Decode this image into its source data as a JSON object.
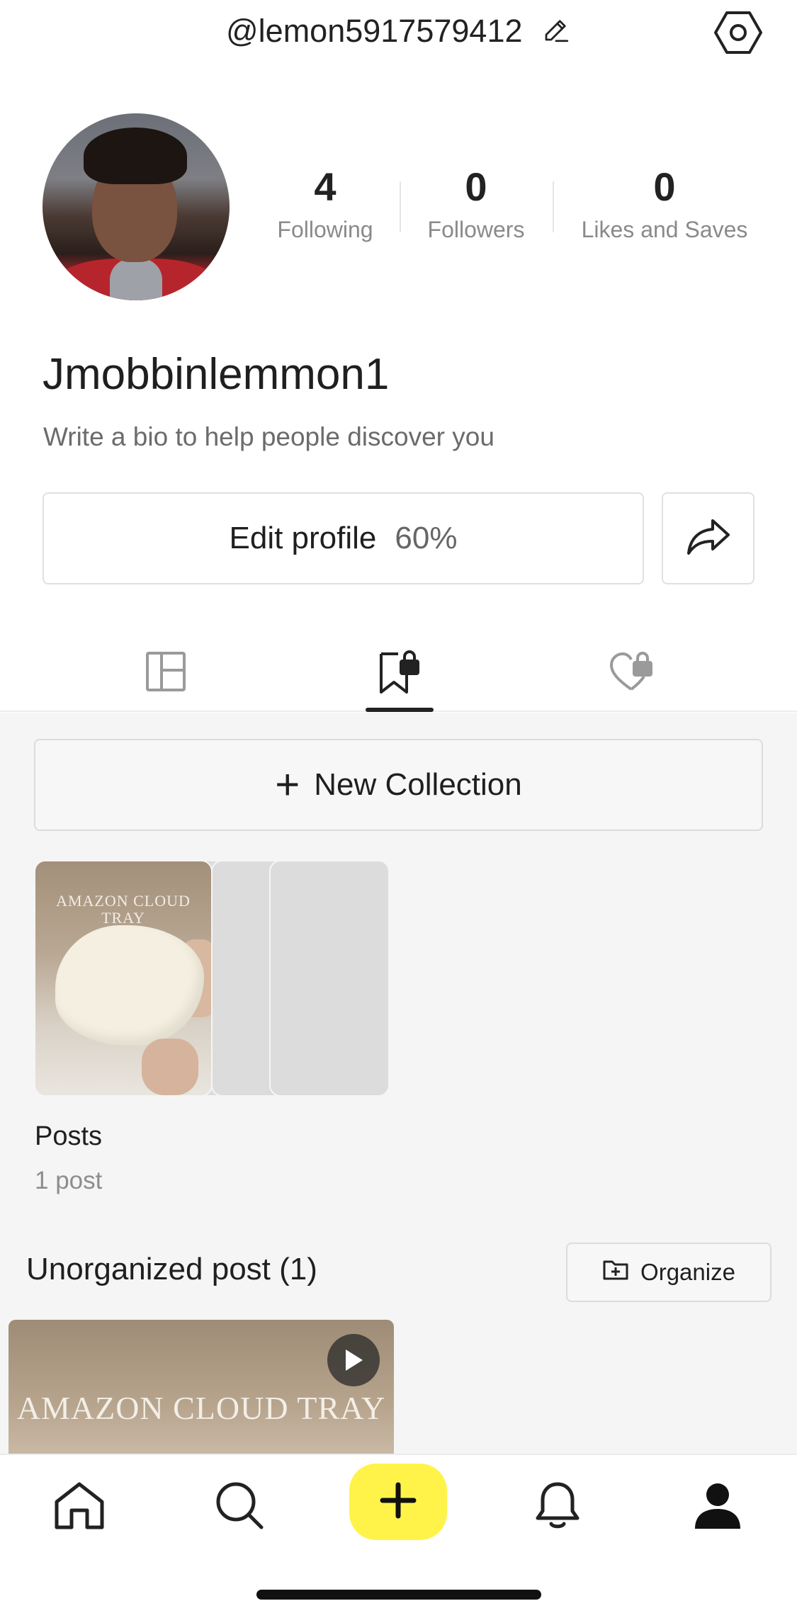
{
  "header": {
    "handle": "@lemon5917579412"
  },
  "profile": {
    "username": "Jmobbinlemmon1",
    "bio": "Write a bio to help people discover you"
  },
  "stats": [
    {
      "value": "4",
      "label": "Following"
    },
    {
      "value": "0",
      "label": "Followers"
    },
    {
      "value": "0",
      "label": "Likes and Saves"
    }
  ],
  "actions": {
    "edit_label": "Edit profile",
    "edit_percent": "60%"
  },
  "tabs": [
    {
      "icon": "grid-icon",
      "active": false
    },
    {
      "icon": "bookmark-lock-icon",
      "active": true
    },
    {
      "icon": "heart-lock-icon",
      "active": false
    }
  ],
  "collections": {
    "new_label": "New Collection",
    "items": [
      {
        "title": "Posts",
        "count": "1 post",
        "cover_text": "AMAZON CLOUD TRAY"
      }
    ]
  },
  "unorganized": {
    "title": "Unorganized post (1)",
    "organize_label": "Organize",
    "thumb_text": "AMAZON CLOUD TRAY"
  },
  "bottom_nav": [
    {
      "icon": "home-icon"
    },
    {
      "icon": "search-icon"
    },
    {
      "icon": "plus-icon"
    },
    {
      "icon": "bell-icon"
    },
    {
      "icon": "profile-icon"
    }
  ],
  "colors": {
    "accent": "#fff34a",
    "background": "#f5f5f5",
    "text": "#1f1f1f",
    "muted": "#8a8a8a"
  }
}
